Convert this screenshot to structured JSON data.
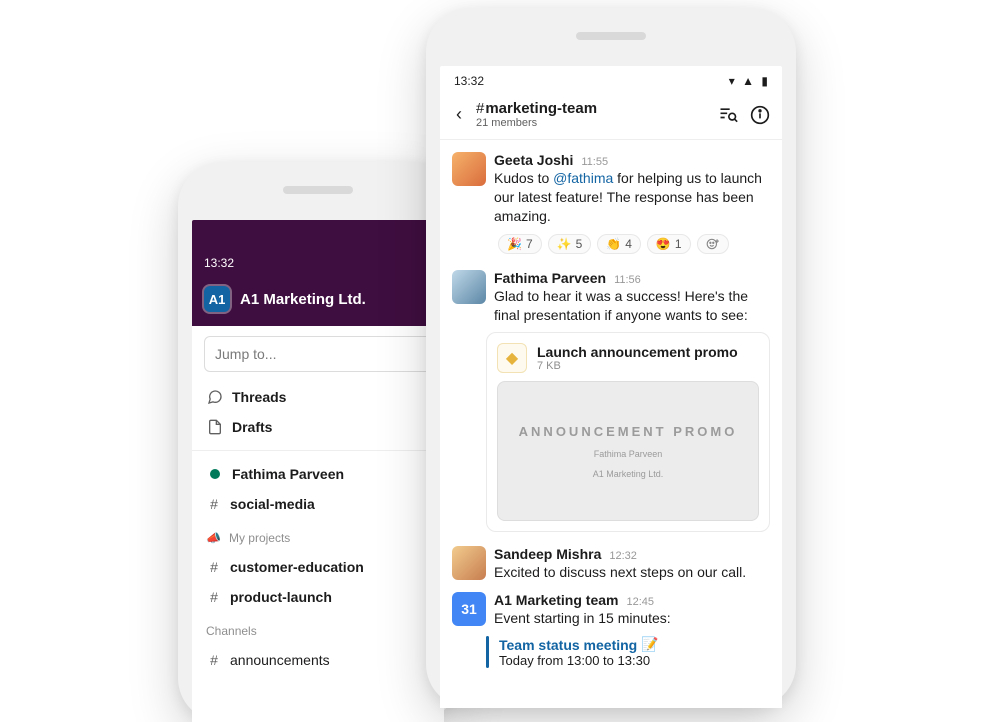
{
  "phoneA": {
    "status_time": "13:32",
    "workspace_badge": "A1",
    "workspace_name": "A1 Marketing Ltd.",
    "search_placeholder": "Jump to...",
    "items": {
      "threads": "Threads",
      "drafts": "Drafts"
    },
    "dm_name": "Fathima Parveen",
    "ch_social": "social-media",
    "section_myprojects": "My projects",
    "ch_customer": "customer-education",
    "ch_product": "product-launch",
    "section_channels": "Channels",
    "ch_announcements": "announcements"
  },
  "phoneB": {
    "status_time": "13:32",
    "channel_name": "marketing-team",
    "channel_members": "21 members",
    "msg1": {
      "name": "Geeta Joshi",
      "ts": "11:55",
      "text_pre": "Kudos to ",
      "mention": "@fathima",
      "text_post": " for helping us to launch our latest feature! The response has been amazing.",
      "reactions": [
        {
          "emoji": "🎉",
          "count": "7"
        },
        {
          "emoji": "✨",
          "count": "5"
        },
        {
          "emoji": "👏",
          "count": "4"
        },
        {
          "emoji": "😍",
          "count": "1"
        }
      ]
    },
    "msg2": {
      "name": "Fathima Parveen",
      "ts": "11:56",
      "text": "Glad to hear it was a success! Here's the final presentation if anyone wants to see:",
      "attach_title": "Launch announcement promo",
      "attach_meta": "7 KB",
      "slide_title": "ANNOUNCEMENT PROMO",
      "slide_line1": "Fathima Parveen",
      "slide_line2": "A1 Marketing Ltd."
    },
    "msg3": {
      "name": "Sandeep Mishra",
      "ts": "12:32",
      "text": "Excited to discuss next steps on our call."
    },
    "event": {
      "app_name": "A1 Marketing team",
      "ts": "12:45",
      "cal_day": "31",
      "lead": "Event starting in 15 minutes:",
      "title": "Team status meeting",
      "emoji": "📝",
      "time": "Today from 13:00 to 13:30"
    }
  }
}
